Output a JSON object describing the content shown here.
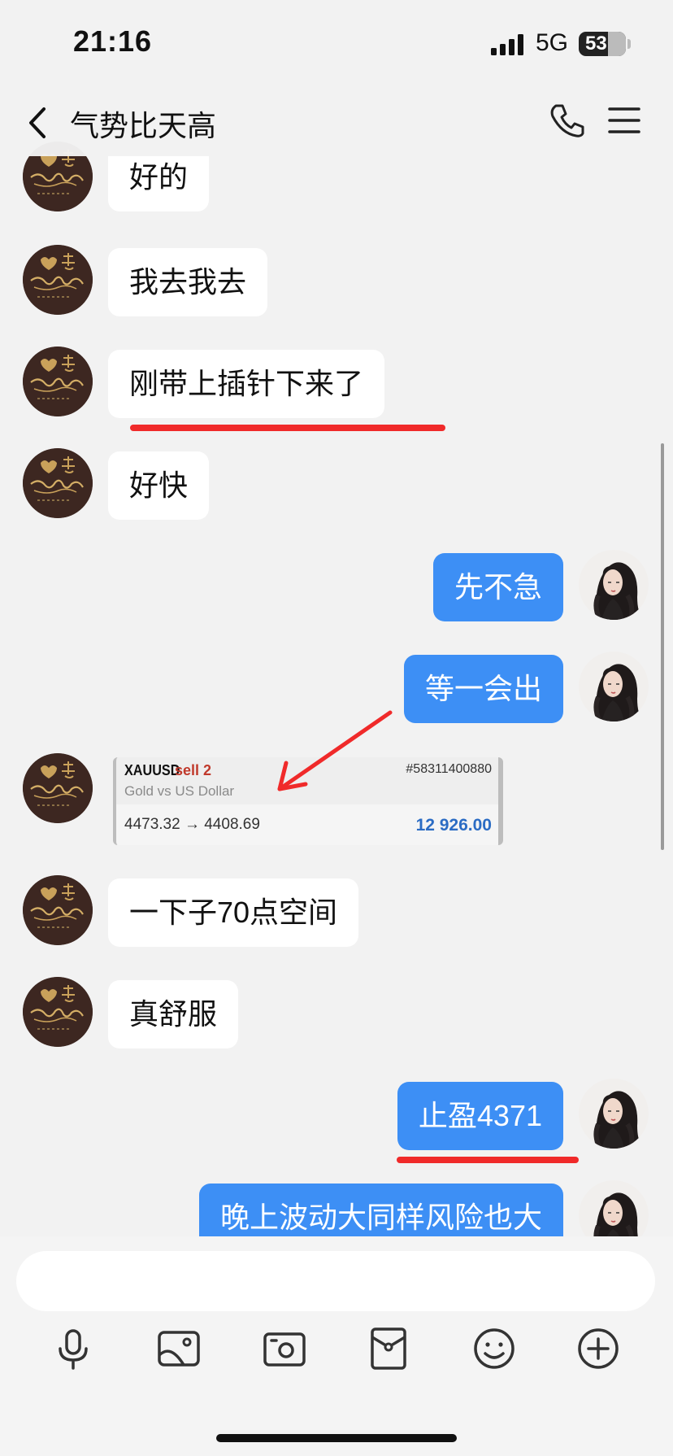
{
  "status_bar": {
    "time": "21:16",
    "network": "5G",
    "battery": "53"
  },
  "header": {
    "title": "气势比天高"
  },
  "messages": [
    {
      "side": "in",
      "text": "好的"
    },
    {
      "side": "in",
      "text": "我去我去"
    },
    {
      "side": "in",
      "text": "刚带上插针下来了",
      "annotated": true
    },
    {
      "side": "in",
      "text": "好快"
    },
    {
      "side": "out",
      "text": "先不急"
    },
    {
      "side": "out",
      "text": "等一会出"
    },
    {
      "side": "in",
      "type": "trade-card"
    },
    {
      "side": "in",
      "text": "一下子70点空间"
    },
    {
      "side": "in",
      "text": "真舒服"
    },
    {
      "side": "out",
      "text": "止盈4371",
      "annotated": true
    },
    {
      "side": "out",
      "text": "晚上波动大同样风险也大"
    }
  ],
  "trade_card": {
    "symbol": "XAUUSD",
    "side": "sell 2",
    "order_id": "#58311400880",
    "description": "Gold vs US Dollar",
    "prices": "4473.32 → 4408.69",
    "profit": "12 926.00"
  },
  "composer": {
    "input_value": "",
    "tools": [
      "microphone-icon",
      "image-icon",
      "camera-icon",
      "red-packet-icon",
      "emoji-icon",
      "plus-icon"
    ]
  },
  "colors": {
    "outgoing_bubble": "#3d8ff5",
    "annotation": "#f02a2a",
    "profit": "#2b6cc4",
    "sell": "#c0392b"
  }
}
